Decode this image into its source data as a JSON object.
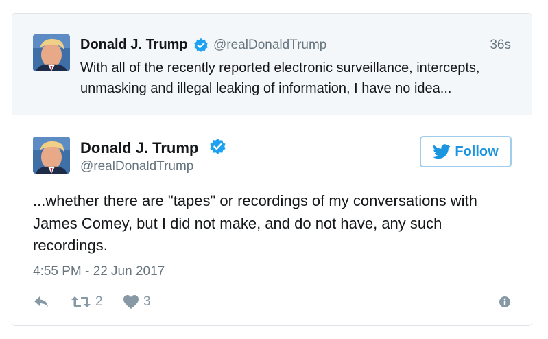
{
  "quoted_tweet": {
    "name": "Donald J. Trump",
    "handle": "@realDonaldTrump",
    "time": "36s",
    "text": "With all of the recently reported electronic surveillance, intercepts, unmasking and illegal leaking of information, I have no idea..."
  },
  "main_tweet": {
    "name": "Donald J. Trump",
    "handle": "@realDonaldTrump",
    "follow_label": "Follow",
    "text": "...whether there are \"tapes\" or recordings of my conversations with James Comey, but I did not make, and do not have, any such recordings.",
    "timestamp": "4:55 PM - 22 Jun 2017",
    "retweet_count": "2",
    "like_count": "3"
  },
  "icons": {
    "verified": "verified-badge-icon",
    "follow": "twitter-bird-icon",
    "reply": "reply-icon",
    "retweet": "retweet-icon",
    "like": "heart-icon",
    "info": "info-icon"
  },
  "colors": {
    "accent": "#1b95e0",
    "verified": "#1da1f2",
    "muted": "#66757f",
    "action": "#8899a6",
    "quoted_background": "#f4f7f9"
  }
}
